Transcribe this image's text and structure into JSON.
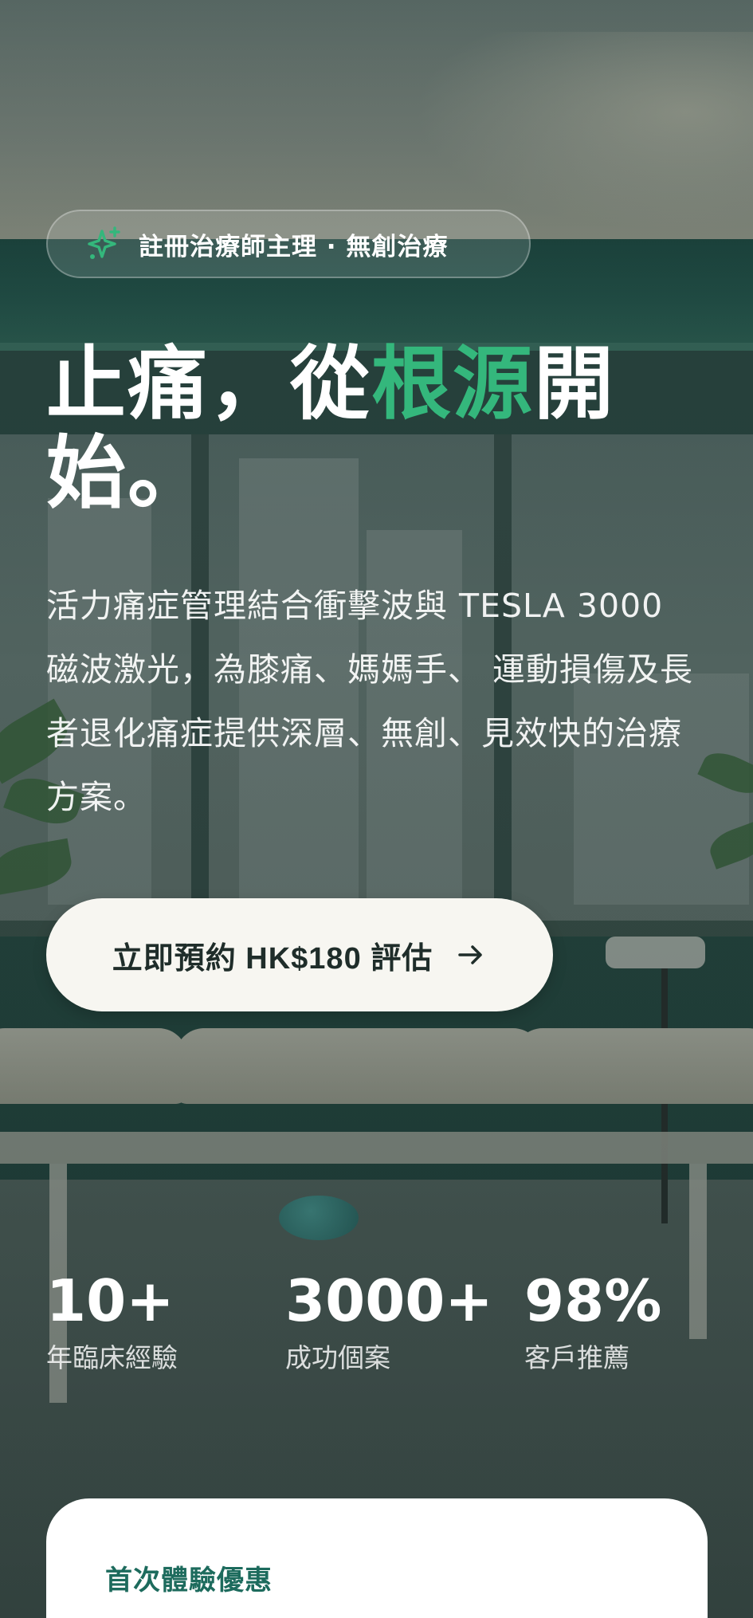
{
  "badge": {
    "text": "註冊治療師主理 · 無創治療",
    "icon": "sparkles-icon",
    "icon_color": "#34b77c"
  },
  "hero": {
    "headline_part1": "止痛，從",
    "headline_accent": "根源",
    "headline_part2": "開始。",
    "accent_color": "#34b77c",
    "description": "活力痛症管理結合衝擊波與 TESLA 3000 磁波激光，為膝痛、媽媽手、 運動損傷及長者退化痛症提供深層、無創、見效快的治療方案。"
  },
  "cta": {
    "label": "立即預約 HK$180 評估",
    "icon": "arrow-right-icon"
  },
  "stats": [
    {
      "value": "10+",
      "label": "年臨床經驗"
    },
    {
      "value": "3000+",
      "label": "成功個案"
    },
    {
      "value": "98%",
      "label": "客戶推薦"
    }
  ],
  "offer": {
    "title": "首次體驗優惠"
  }
}
